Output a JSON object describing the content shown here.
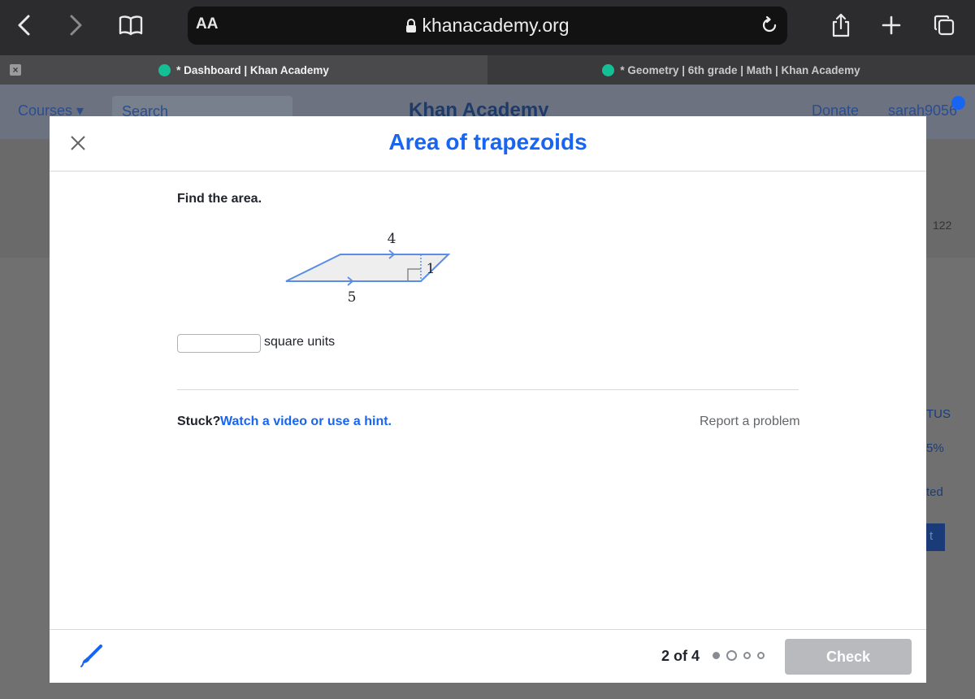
{
  "browser": {
    "aa_label": "AA",
    "url": "khanacademy.org",
    "icons": [
      "back-icon",
      "forward-icon",
      "bookmarks-icon",
      "lock-icon",
      "reload-icon",
      "share-icon",
      "new-tab-icon",
      "tabs-icon"
    ]
  },
  "tabs": [
    {
      "label": "* Dashboard | Khan Academy",
      "active": true
    },
    {
      "label": "* Geometry | 6th grade | Math | Khan Academy",
      "active": false
    }
  ],
  "background_page": {
    "courses": "Courses ▾",
    "search_placeholder": "Search",
    "logo": "Khan Academy",
    "donate": "Donate",
    "user": "sarah9056",
    "points": "122",
    "side_fragments": [
      "TUS",
      "5%",
      "ted",
      "t"
    ]
  },
  "modal": {
    "title": "Area of trapezoids",
    "prompt": "Find the area.",
    "figure": {
      "top_base": "4",
      "bottom_base": "5",
      "height": "1",
      "colors": {
        "stroke": "#5b8de6",
        "fill": "#eeeeee"
      }
    },
    "answer_value": "",
    "units": "square units",
    "stuck": "Stuck?",
    "hint_link": "Watch a video or use a hint.",
    "report": "Report a problem",
    "progress": "2 of 4",
    "progress_current": 2,
    "progress_total": 4,
    "check": "Check"
  },
  "colors": {
    "accent": "#1865f2",
    "check_disabled": "#b8babe"
  }
}
